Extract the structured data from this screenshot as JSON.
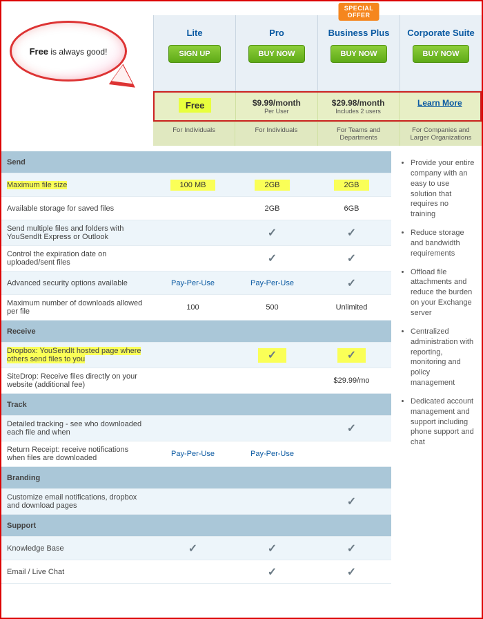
{
  "callout": {
    "bold": "Free",
    "rest": " is always good!"
  },
  "special_offer": "SPECIAL OFFER",
  "plans": [
    {
      "name": "Lite",
      "button": "SIGN UP",
      "price": "Free",
      "sub": "",
      "audience": "For Individuals"
    },
    {
      "name": "Pro",
      "button": "BUY NOW",
      "price": "$9.99/month",
      "sub": "Per User",
      "audience": "For Individuals"
    },
    {
      "name": "Business Plus",
      "button": "BUY NOW",
      "price": "$29.98/month",
      "sub": "Includes 2 users",
      "audience": "For Teams and Departments",
      "special": true
    },
    {
      "name": "Corporate Suite",
      "button": "BUY NOW",
      "price": "Learn More",
      "sub": "",
      "audience": "For Companies and Larger Organizations",
      "learn_more": true
    }
  ],
  "sections": {
    "send": {
      "title": "Send",
      "rows": [
        {
          "label": "Maximum file size",
          "vals": [
            "100 MB",
            "2GB",
            "2GB"
          ],
          "hl_label": true,
          "hl_cells": [
            0,
            1,
            2
          ]
        },
        {
          "label": "Available storage for saved files",
          "vals": [
            "",
            "2GB",
            "6GB"
          ]
        },
        {
          "label": "Send multiple files and folders with YouSendIt Express or Outlook",
          "vals": [
            "",
            "✓",
            "✓"
          ]
        },
        {
          "label": "Control the expiration date on uploaded/sent files",
          "vals": [
            "",
            "✓",
            "✓"
          ]
        },
        {
          "label": "Advanced security options available",
          "vals": [
            "Pay-Per-Use",
            "Pay-Per-Use",
            "✓"
          ],
          "ppu": [
            0,
            1
          ]
        },
        {
          "label": "Maximum number of downloads allowed per file",
          "vals": [
            "100",
            "500",
            "Unlimited"
          ]
        }
      ]
    },
    "receive": {
      "title": "Receive",
      "rows": [
        {
          "label": "Dropbox: YouSendIt hosted page where others send files to you",
          "vals": [
            "",
            "✓",
            "✓"
          ],
          "hl_label": true,
          "hl_row_cells": true
        },
        {
          "label": "SiteDrop: Receive files directly on your website (additional fee)",
          "vals": [
            "",
            "",
            "$29.99/mo"
          ]
        }
      ]
    },
    "track": {
      "title": "Track",
      "rows": [
        {
          "label": "Detailed tracking - see who downloaded each file and when",
          "vals": [
            "",
            "",
            "✓"
          ]
        },
        {
          "label": "Return Receipt: receive notifications when files are downloaded",
          "vals": [
            "Pay-Per-Use",
            "Pay-Per-Use",
            ""
          ],
          "ppu": [
            0,
            1
          ]
        }
      ]
    },
    "branding": {
      "title": "Branding",
      "rows": [
        {
          "label": "Customize email notifications, dropbox and download pages",
          "vals": [
            "",
            "",
            "✓"
          ]
        }
      ]
    },
    "support": {
      "title": "Support",
      "rows": [
        {
          "label": "Knowledge Base",
          "vals": [
            "✓",
            "✓",
            "✓"
          ]
        },
        {
          "label": "Email / Live Chat",
          "vals": [
            "",
            "✓",
            "✓"
          ]
        }
      ]
    }
  },
  "right_features": [
    "Provide your entire company with an easy to use solution that requires no training",
    "Reduce storage and bandwidth requirements",
    "Offload file attachments and reduce the burden on your Exchange server",
    "Centralized administration with reporting, monitoring and policy management",
    "Dedicated account management and support including phone support and chat"
  ]
}
